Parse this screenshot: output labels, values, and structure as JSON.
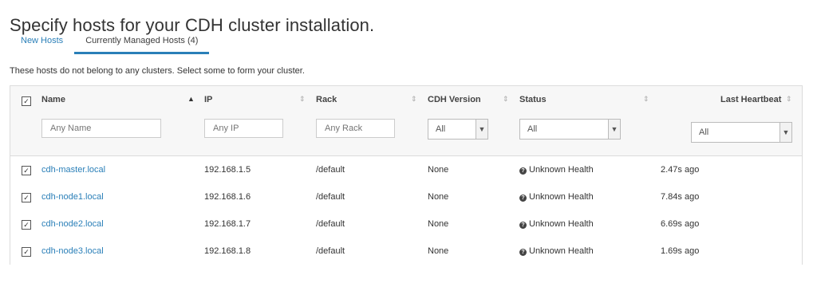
{
  "page": {
    "title": "Specify hosts for your CDH cluster installation.",
    "tabs": [
      "New Hosts",
      "Currently Managed Hosts (4)"
    ],
    "subtitle": "These hosts do not belong to any clusters. Select some to form your cluster."
  },
  "table": {
    "columns": [
      "Name",
      "IP",
      "Rack",
      "CDH Version",
      "Status",
      "Last Heartbeat"
    ],
    "filters": {
      "name_placeholder": "Any Name",
      "ip_placeholder": "Any IP",
      "rack_placeholder": "Any Rack",
      "cdh_version": "All",
      "status": "All",
      "last_heartbeat": "All"
    },
    "rows": [
      {
        "name": "cdh-master.local",
        "ip": "192.168.1.5",
        "rack": "/default",
        "cdh": "None",
        "status": "Unknown Health",
        "heartbeat": "2.47s ago",
        "selected": true
      },
      {
        "name": "cdh-node1.local",
        "ip": "192.168.1.6",
        "rack": "/default",
        "cdh": "None",
        "status": "Unknown Health",
        "heartbeat": "7.84s ago",
        "selected": true
      },
      {
        "name": "cdh-node2.local",
        "ip": "192.168.1.7",
        "rack": "/default",
        "cdh": "None",
        "status": "Unknown Health",
        "heartbeat": "6.69s ago",
        "selected": true
      },
      {
        "name": "cdh-node3.local",
        "ip": "192.168.1.8",
        "rack": "/default",
        "cdh": "None",
        "status": "Unknown Health",
        "heartbeat": "1.69s ago",
        "selected": true
      }
    ]
  },
  "colors": {
    "accent": "#2a7fb8",
    "header_bg": "#f7f7f7",
    "border": "#dcdcdc"
  },
  "icons": {
    "checkbox_checked": "☑",
    "sort": "sort-icon",
    "status": "question-circle-icon",
    "dropdown": "chevron-down-icon"
  }
}
